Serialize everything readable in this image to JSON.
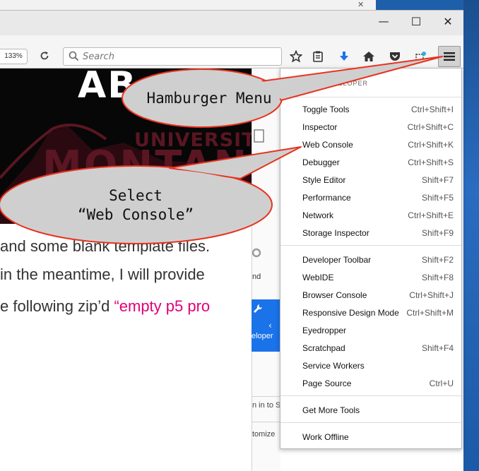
{
  "browser": {
    "zoom_level": "133%",
    "search_placeholder": "Search",
    "window_controls": {
      "minimize": "—",
      "maximize": "☐",
      "close": "✕"
    }
  },
  "page": {
    "banner_title": "AB",
    "banner_university": "UNIVERSITY",
    "banner_montana": "MONTAN",
    "line1": "and some blank template files.",
    "line2": "in the meantime, I will provide",
    "line3_prefix": "e following zip’d ",
    "line3_link": "“empty p5 pro",
    "side_blue_label": "eloper",
    "side_text_1": "nd",
    "side_text_2": "n in to S",
    "side_text_3": "tomize"
  },
  "menu": {
    "header": "DEVELOPER",
    "groups": [
      [
        {
          "label": "Toggle Tools",
          "shortcut": "Ctrl+Shift+I"
        },
        {
          "label": "Inspector",
          "shortcut": "Ctrl+Shift+C"
        },
        {
          "label": "Web Console",
          "shortcut": "Ctrl+Shift+K"
        },
        {
          "label": "Debugger",
          "shortcut": "Ctrl+Shift+S"
        },
        {
          "label": "Style Editor",
          "shortcut": "Shift+F7"
        },
        {
          "label": "Performance",
          "shortcut": "Shift+F5"
        },
        {
          "label": "Network",
          "shortcut": "Ctrl+Shift+E"
        },
        {
          "label": "Storage Inspector",
          "shortcut": "Shift+F9"
        }
      ],
      [
        {
          "label": "Developer Toolbar",
          "shortcut": "Shift+F2"
        },
        {
          "label": "WebIDE",
          "shortcut": "Shift+F8"
        },
        {
          "label": "Browser Console",
          "shortcut": "Ctrl+Shift+J"
        },
        {
          "label": "Responsive Design Mode",
          "shortcut": "Ctrl+Shift+M"
        },
        {
          "label": "Eyedropper",
          "shortcut": ""
        },
        {
          "label": "Scratchpad",
          "shortcut": "Shift+F4"
        },
        {
          "label": "Service Workers",
          "shortcut": ""
        },
        {
          "label": "Page Source",
          "shortcut": "Ctrl+U"
        }
      ],
      [
        {
          "label": "Get More Tools",
          "shortcut": ""
        }
      ],
      [
        {
          "label": "Work Offline",
          "shortcut": ""
        }
      ]
    ]
  },
  "callouts": {
    "hamburger": "Hamburger Menu",
    "select_line1": "Select",
    "select_line2": "“Web Console”"
  },
  "colors": {
    "callout_fill": "#cfcfcf",
    "callout_stroke": "#e8321e",
    "link": "#e0007a",
    "desktop": "#1d5fa8"
  }
}
